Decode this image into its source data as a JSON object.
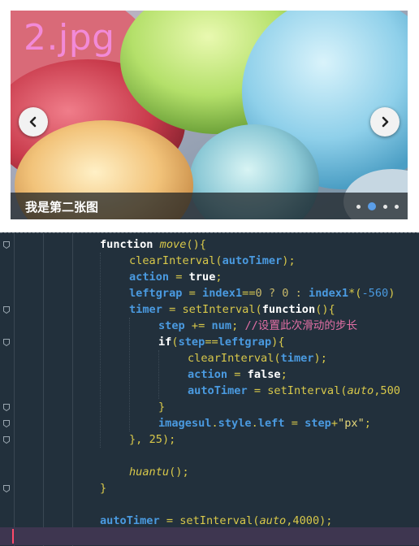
{
  "carousel": {
    "slide_title": "2.jpg",
    "caption": "我是第二张图",
    "prev_label": "previous",
    "next_label": "next",
    "slide_count": 4,
    "active_index": 1,
    "icons": {
      "prev": "chevron-left-icon",
      "next": "chevron-right-icon"
    }
  },
  "editor": {
    "lines": [
      [
        [
          "kw",
          "function "
        ],
        [
          "fn",
          "move"
        ],
        [
          "op",
          "(){"
        ]
      ],
      [
        [
          "bi",
          "clearInterval"
        ],
        [
          "op",
          "("
        ],
        [
          "id",
          "autoTimer"
        ],
        [
          "op",
          ");"
        ]
      ],
      [
        [
          "id",
          "action"
        ],
        [
          "op",
          " = "
        ],
        [
          "kw",
          "true"
        ],
        [
          "op",
          ";"
        ]
      ],
      [
        [
          "id",
          "leftgrap"
        ],
        [
          "op",
          " = "
        ],
        [
          "id",
          "index1"
        ],
        [
          "op",
          "=="
        ],
        [
          "tern",
          "0 ? 0 : "
        ],
        [
          "id",
          "index1"
        ],
        [
          "op",
          "*("
        ],
        [
          "num",
          "-560"
        ],
        [
          "op",
          ")"
        ]
      ],
      [
        [
          "id",
          "timer"
        ],
        [
          "op",
          " = "
        ],
        [
          "bi",
          "setInterval"
        ],
        [
          "op",
          "("
        ],
        [
          "kw",
          "function"
        ],
        [
          "op",
          "(){"
        ]
      ],
      [
        [
          "id",
          "step"
        ],
        [
          "op",
          " += "
        ],
        [
          "id",
          "num"
        ],
        [
          "op",
          "; "
        ],
        [
          "cm",
          "//设置此次滑动的步长"
        ]
      ],
      [
        [
          "kw",
          "if"
        ],
        [
          "op",
          "("
        ],
        [
          "id",
          "step"
        ],
        [
          "op",
          "=="
        ],
        [
          "id",
          "leftgrap"
        ],
        [
          "op",
          "){"
        ]
      ],
      [
        [
          "bi",
          "clearInterval"
        ],
        [
          "op",
          "("
        ],
        [
          "id",
          "timer"
        ],
        [
          "op",
          ");"
        ]
      ],
      [
        [
          "id",
          "action"
        ],
        [
          "op",
          " = "
        ],
        [
          "kw",
          "false"
        ],
        [
          "op",
          ";"
        ]
      ],
      [
        [
          "id",
          "autoTimer"
        ],
        [
          "op",
          " = "
        ],
        [
          "bi",
          "setInterval"
        ],
        [
          "op",
          "("
        ],
        [
          "fn",
          "auto"
        ],
        [
          "op",
          ",500"
        ]
      ],
      [
        [
          "op",
          "}"
        ]
      ],
      [
        [
          "id",
          "imagesul"
        ],
        [
          "op",
          "."
        ],
        [
          "id",
          "style"
        ],
        [
          "op",
          "."
        ],
        [
          "id",
          "left"
        ],
        [
          "op",
          " = "
        ],
        [
          "id",
          "step"
        ],
        [
          "op",
          "+"
        ],
        [
          "str",
          "\"px\""
        ],
        [
          "op",
          ";"
        ]
      ],
      [
        [
          "op",
          "}, "
        ],
        [
          "op",
          "25"
        ],
        [
          "op",
          ");"
        ]
      ],
      [],
      [
        [
          "fn",
          "huantu"
        ],
        [
          "op",
          "();"
        ]
      ],
      [
        [
          "op",
          "}"
        ]
      ],
      [],
      [
        [
          "id",
          "autoTimer"
        ],
        [
          "op",
          " = "
        ],
        [
          "bi",
          "setInterval"
        ],
        [
          "op",
          "("
        ],
        [
          "fn",
          "auto"
        ],
        [
          "op",
          ",4000"
        ],
        [
          "op",
          ");"
        ]
      ],
      []
    ]
  }
}
